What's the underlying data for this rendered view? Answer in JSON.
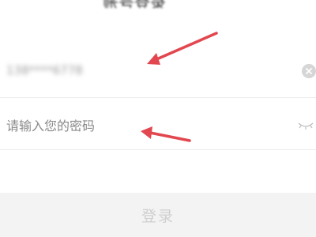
{
  "header": {
    "title_partial": "账号登录"
  },
  "login_form": {
    "account_value_blurred": "138****6778",
    "password_placeholder": "请输入您的密码",
    "login_button_label": "登录"
  },
  "icons": {
    "clear": "clear-icon",
    "visibility": "eye-closed-icon"
  },
  "colors": {
    "annotation_arrow": "#e2474f",
    "button_disabled_bg": "#f3f3f3",
    "button_disabled_text": "#cfcfcf"
  }
}
